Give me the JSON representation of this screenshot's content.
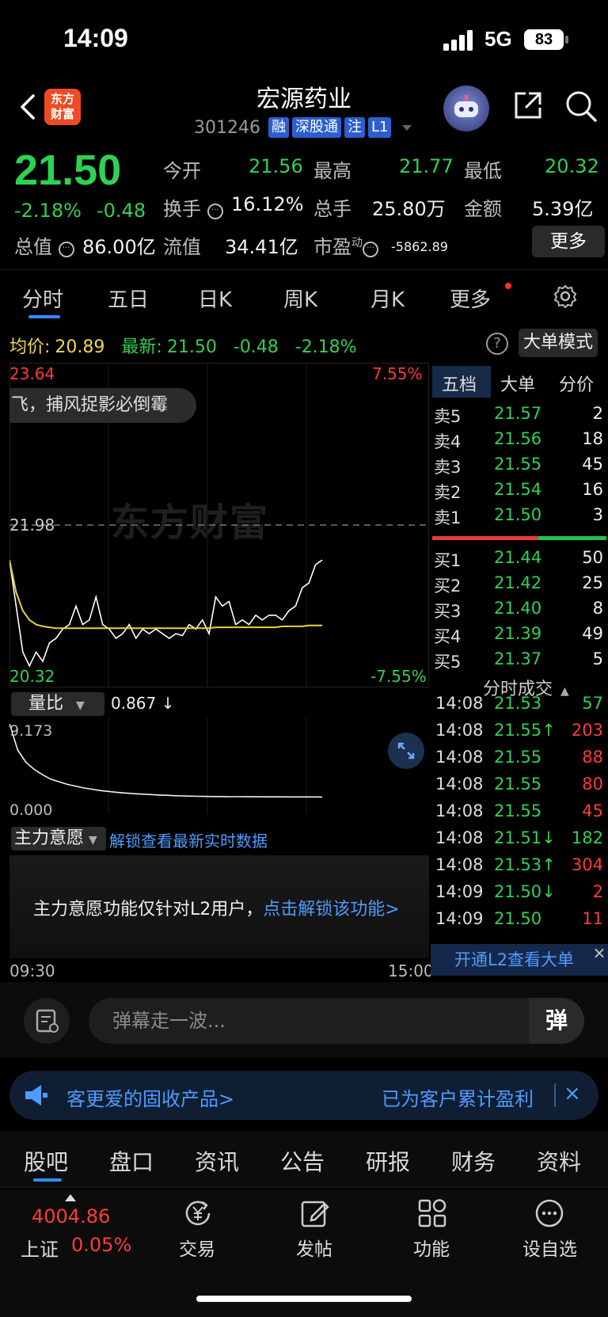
{
  "status": {
    "time": "14:09",
    "network": "5G",
    "battery": "83"
  },
  "header": {
    "logo_line1": "东方",
    "logo_line2": "财富",
    "title": "宏源药业",
    "code": "301246",
    "tags": [
      "融",
      "深股通",
      "注",
      "L1"
    ]
  },
  "quote": {
    "price": "21.50",
    "change_pct": "-2.18%",
    "change_abs": "-0.48",
    "open_label": "今开",
    "open": "21.56",
    "high_label": "最高",
    "high": "21.77",
    "low_label": "最低",
    "low": "20.32",
    "turnover_label": "换手",
    "turnover": "16.12%",
    "volume_label": "总手",
    "volume": "25.80万",
    "amount_label": "金额",
    "amount": "5.39亿",
    "mktcap_label": "总值",
    "mktcap": "86.00亿",
    "float_label": "流值",
    "float": "34.41亿",
    "pe_label": "市盈",
    "pe_sup": "动",
    "pe": "-5862.89",
    "more": "更多"
  },
  "chart_tabs": [
    "分时",
    "五日",
    "日K",
    "周K",
    "月K",
    "更多"
  ],
  "avg_row": {
    "avg_label": "均价:",
    "avg": "20.89",
    "latest_label": "最新:",
    "latest": "21.50",
    "chg": "-0.48",
    "pct": "-2.18%"
  },
  "big_mode": "大单模式",
  "help": "?",
  "chart": {
    "high": "23.64",
    "high_pct": "7.55%",
    "ref": "21.98",
    "low": "20.32",
    "low_pct": "-7.55%",
    "danmu": "飞，捕风捉影必倒霉",
    "watermark": "东方财富",
    "time_start": "09:30",
    "time_end": "15:00"
  },
  "chart_data": {
    "type": "line",
    "ylim": [
      20.32,
      23.64
    ],
    "reference": 21.98,
    "series": [
      {
        "name": "最新",
        "values": [
          21.6,
          21.1,
          20.6,
          20.45,
          20.6,
          20.5,
          20.7,
          20.75,
          20.85,
          20.9,
          21.1,
          20.9,
          20.95,
          21.2,
          20.9,
          20.85,
          20.75,
          20.8,
          20.9,
          20.75,
          20.85,
          20.8,
          20.85,
          20.8,
          20.75,
          20.8,
          20.78,
          20.9,
          20.85,
          20.95,
          20.8,
          21.2,
          21.1,
          21.15,
          20.9,
          20.95,
          20.9,
          21.0,
          20.95,
          21.0,
          21.0,
          20.95,
          21.05,
          21.1,
          21.3,
          21.35,
          21.55,
          21.6
        ]
      },
      {
        "name": "均价",
        "values": [
          21.6,
          21.25,
          21.05,
          20.95,
          20.9,
          20.88,
          20.87,
          20.86,
          20.86,
          20.86,
          20.86,
          20.86,
          20.86,
          20.86,
          20.86,
          20.86,
          20.86,
          20.86,
          20.86,
          20.86,
          20.86,
          20.86,
          20.86,
          20.86,
          20.86,
          20.86,
          20.86,
          20.86,
          20.86,
          20.86,
          20.86,
          20.87,
          20.87,
          20.87,
          20.87,
          20.87,
          20.87,
          20.87,
          20.87,
          20.87,
          20.87,
          20.88,
          20.88,
          20.88,
          20.88,
          20.89,
          20.89,
          20.89
        ]
      }
    ]
  },
  "volume_ratio": {
    "label": "量比",
    "value": "0.867 ↓",
    "top": "9.173",
    "bottom": "0.000",
    "values": [
      9.173,
      6.2,
      4.8,
      4.0,
      3.4,
      2.9,
      2.6,
      2.3,
      2.1,
      1.9,
      1.75,
      1.6,
      1.5,
      1.4,
      1.32,
      1.25,
      1.2,
      1.15,
      1.1,
      1.06,
      1.02,
      0.99,
      0.96,
      0.94,
      0.93,
      0.92,
      0.91,
      0.9,
      0.9,
      0.89,
      0.89,
      0.88,
      0.88,
      0.88,
      0.87,
      0.87,
      0.87,
      0.87,
      0.867
    ]
  },
  "zhuli": {
    "label": "主力意愿",
    "link": "解锁查看最新实时数据",
    "text": "主力意愿功能仅针对L2用户，",
    "text_link": "点击解锁该功能>"
  },
  "orderbook": {
    "tabs": [
      "五档",
      "大单",
      "分价"
    ],
    "sell": [
      {
        "label": "卖5",
        "price": "21.57",
        "vol": "2"
      },
      {
        "label": "卖4",
        "price": "21.56",
        "vol": "18"
      },
      {
        "label": "卖3",
        "price": "21.55",
        "vol": "45"
      },
      {
        "label": "卖2",
        "price": "21.54",
        "vol": "16"
      },
      {
        "label": "卖1",
        "price": "21.50",
        "vol": "3"
      }
    ],
    "buy": [
      {
        "label": "买1",
        "price": "21.44",
        "vol": "50"
      },
      {
        "label": "买2",
        "price": "21.42",
        "vol": "25"
      },
      {
        "label": "买3",
        "price": "21.40",
        "vol": "8"
      },
      {
        "label": "买4",
        "price": "21.39",
        "vol": "49"
      },
      {
        "label": "买5",
        "price": "21.37",
        "vol": "5"
      }
    ],
    "ticks_title": "分时成交",
    "ticks": [
      {
        "time": "14:08",
        "price": "21.53",
        "vol": "57",
        "color": "#2fd153"
      },
      {
        "time": "14:08",
        "price": "21.55↑",
        "vol": "203",
        "color": "#ff3b3b"
      },
      {
        "time": "14:08",
        "price": "21.55",
        "vol": "88",
        "color": "#ff3b3b"
      },
      {
        "time": "14:08",
        "price": "21.55",
        "vol": "80",
        "color": "#ff3b3b"
      },
      {
        "time": "14:08",
        "price": "21.55",
        "vol": "45",
        "color": "#ff3b3b"
      },
      {
        "time": "14:08",
        "price": "21.51↓",
        "vol": "182",
        "color": "#2fd153"
      },
      {
        "time": "14:08",
        "price": "21.53↑",
        "vol": "304",
        "color": "#ff3b3b"
      },
      {
        "time": "14:09",
        "price": "21.50↓",
        "vol": "2",
        "color": "#ff3b3b"
      },
      {
        "time": "14:09",
        "price": "21.50",
        "vol": "11",
        "color": "#ff3b3b"
      }
    ],
    "l2": "开通L2查看大单",
    "close": "×"
  },
  "comment": {
    "placeholder": "弹幕走一波...",
    "danmu_btn": "弹"
  },
  "ad": {
    "left": "客更爱的固收产品>",
    "right": "已为客户累计盈利",
    "close": "×"
  },
  "bottom_tabs": [
    "股吧",
    "盘口",
    "资讯",
    "公告",
    "研报",
    "财务",
    "资料"
  ],
  "bottom_nav": {
    "index_value": "4004.86",
    "index_label": "上证",
    "index_pct": "0.05%",
    "items": [
      "交易",
      "发帖",
      "功能",
      "设自选"
    ]
  }
}
